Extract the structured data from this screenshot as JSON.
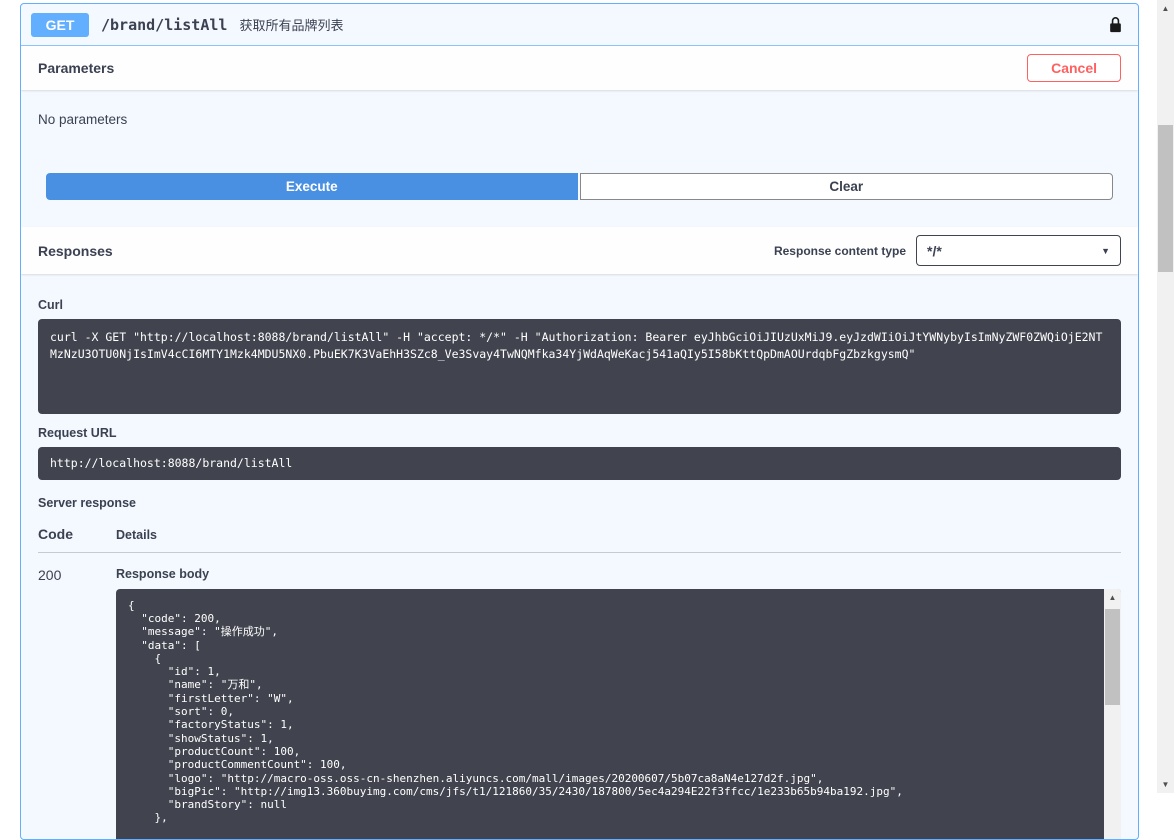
{
  "icons": {
    "select_arrow": "▼",
    "scroll_up_arrow": "▲",
    "scroll_down_arrow": "▼"
  },
  "colors": {
    "method_blue": "#61affe",
    "execute_blue": "#4990e2",
    "cancel_red": "#ff6060",
    "code_block_bg": "#41444e"
  },
  "operation": {
    "method": "GET",
    "path": "/brand/listAll",
    "summary": "获取所有品牌列表"
  },
  "parameters_section": {
    "title": "Parameters",
    "cancel_button": "Cancel",
    "no_parameters": "No parameters",
    "execute_button": "Execute",
    "clear_button": "Clear"
  },
  "responses_section": {
    "title": "Responses",
    "content_type_label": "Response content type",
    "content_type_value": "*/*",
    "curl": {
      "label": "Curl",
      "command": "curl -X GET \"http://localhost:8088/brand/listAll\" -H \"accept: */*\" -H \"Authorization: Bearer eyJhbGciOiJIUzUxMiJ9.eyJzdWIiOiJtYWNybyIsImNyZWF0ZWQiOjE2NTMzNzU3OTU0NjIsImV4cCI6MTY1Mzk4MDU5NX0.PbuEK7K3VaEhH3SZc8_Ve3Svay4TwNQMfka34YjWdAqWeKacj541aQIy5I58bKttQpDmAOUrdqbFgZbzkgysmQ\""
    },
    "request_url": {
      "label": "Request URL",
      "value": "http://localhost:8088/brand/listAll"
    },
    "server_response": {
      "label": "Server response",
      "code_header": "Code",
      "details_header": "Details",
      "status_code": "200",
      "response_body_label": "Response body",
      "response_body": "{\n  \"code\": 200,\n  \"message\": \"操作成功\",\n  \"data\": [\n    {\n      \"id\": 1,\n      \"name\": \"万和\",\n      \"firstLetter\": \"W\",\n      \"sort\": 0,\n      \"factoryStatus\": 1,\n      \"showStatus\": 1,\n      \"productCount\": 100,\n      \"productCommentCount\": 100,\n      \"logo\": \"http://macro-oss.oss-cn-shenzhen.aliyuncs.com/mall/images/20200607/5b07ca8aN4e127d2f.jpg\",\n      \"bigPic\": \"http://img13.360buyimg.com/cms/jfs/t1/121860/35/2430/187800/5ec4a294E22f3ffcc/1e233b65b94ba192.jpg\",\n      \"brandStory\": null\n    },"
    }
  }
}
